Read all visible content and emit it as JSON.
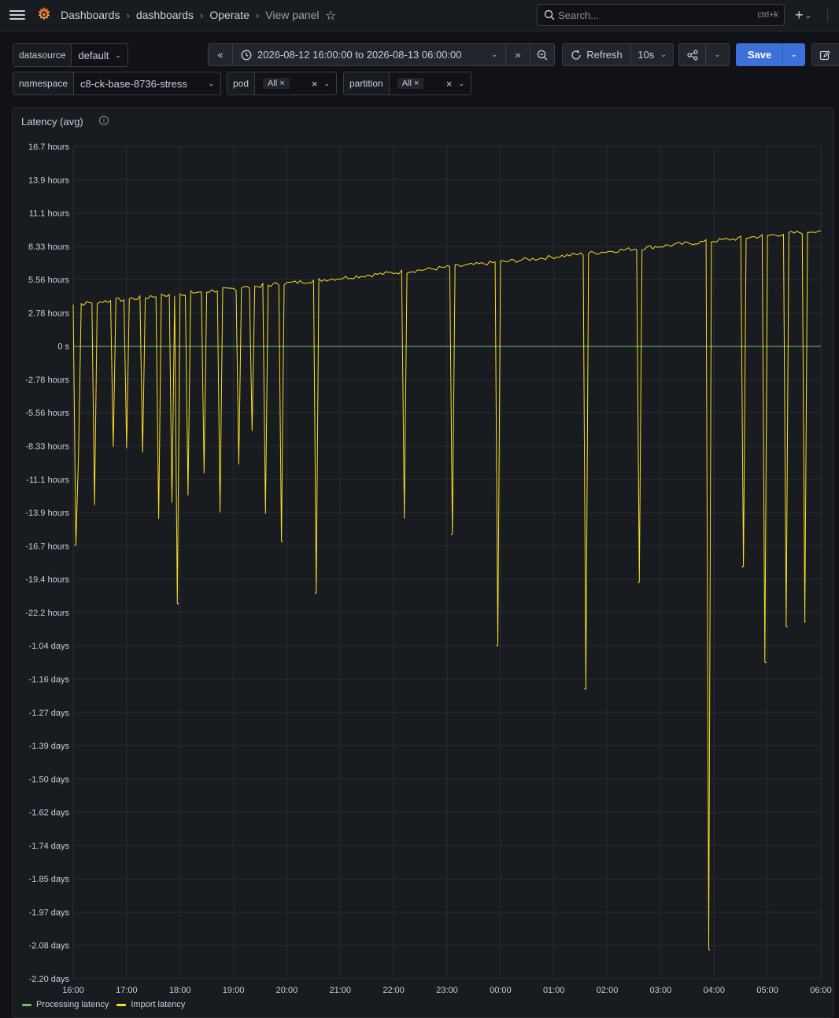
{
  "topbar": {
    "breadcrumb": [
      "Dashboards",
      "dashboards",
      "Operate"
    ],
    "breadcrumb_current": "View panel",
    "search_placeholder": "Search...",
    "search_shortcut": "ctrl+k"
  },
  "variables": {
    "datasource": {
      "label": "datasource",
      "value": "default"
    },
    "namespace": {
      "label": "namespace",
      "value": "c8-ck-base-8736-stress"
    },
    "pod": {
      "label": "pod",
      "value": "All"
    },
    "partition": {
      "label": "partition",
      "value": "All"
    }
  },
  "toolbar": {
    "time_range": "2026-08-12 16:00:00 to 2026-08-13 06:00:00",
    "refresh_label": "Refresh",
    "refresh_interval": "10s",
    "save_label": "Save"
  },
  "panel": {
    "title": "Latency (avg)"
  },
  "colors": {
    "processing": "#73bf69",
    "import": "#fade2a",
    "accent": "#3d71d9"
  },
  "chart_data": {
    "type": "line",
    "x_ticks": [
      "16:00",
      "17:00",
      "18:00",
      "19:00",
      "20:00",
      "21:00",
      "22:00",
      "23:00",
      "00:00",
      "01:00",
      "02:00",
      "03:00",
      "04:00",
      "05:00",
      "06:00"
    ],
    "y_ticks": [
      "16.7 hours",
      "13.9 hours",
      "11.1 hours",
      "8.33 hours",
      "5.56 hours",
      "2.78 hours",
      "0 s",
      "-2.78 hours",
      "-5.56 hours",
      "-8.33 hours",
      "-11.1 hours",
      "-13.9 hours",
      "-16.7 hours",
      "-19.4 hours",
      "-22.2 hours",
      "-1.04 days",
      "-1.16 days",
      "-1.27 days",
      "-1.39 days",
      "-1.50 days",
      "-1.62 days",
      "-1.74 days",
      "-1.85 days",
      "-1.97 days",
      "-2.08 days",
      "-2.20 days"
    ],
    "ylim_hours": [
      -52.8,
      16.7
    ],
    "x_range": [
      "2026-08-12 16:00:00",
      "2026-08-13 06:00:00"
    ],
    "grid": true,
    "legend_position": "bottom-left",
    "series": [
      {
        "name": "Processing latency",
        "trend": "constant",
        "value_hours": 0
      },
      {
        "name": "Import latency",
        "trend": "rising baseline with frequent negative spikes",
        "baseline_start_hours": 3.5,
        "baseline_end_hours": 9.7,
        "spikes": [
          {
            "time": "16:02",
            "min_hours": -16.6
          },
          {
            "time": "17:58",
            "min_hours": -21.5
          },
          {
            "time": "19:55",
            "min_hours": -16.3
          },
          {
            "time": "20:32",
            "min_hours": -20.6
          },
          {
            "time": "22:12",
            "min_hours": -14.3
          },
          {
            "time": "23:05",
            "min_hours": -15.7
          },
          {
            "time": "23:56",
            "min_hours": -25.0
          },
          {
            "time": "01:35",
            "min_hours": -28.6
          },
          {
            "time": "02:35",
            "min_hours": -19.7
          },
          {
            "time": "03:55",
            "min_hours": -50.4
          },
          {
            "time": "04:32",
            "min_hours": -18.4
          },
          {
            "time": "04:58",
            "min_hours": -26.4
          },
          {
            "time": "05:22",
            "min_hours": -23.4
          },
          {
            "time": "05:42",
            "min_hours": -23.0
          }
        ]
      }
    ]
  },
  "legend": [
    {
      "label": "Processing latency"
    },
    {
      "label": "Import latency"
    }
  ]
}
